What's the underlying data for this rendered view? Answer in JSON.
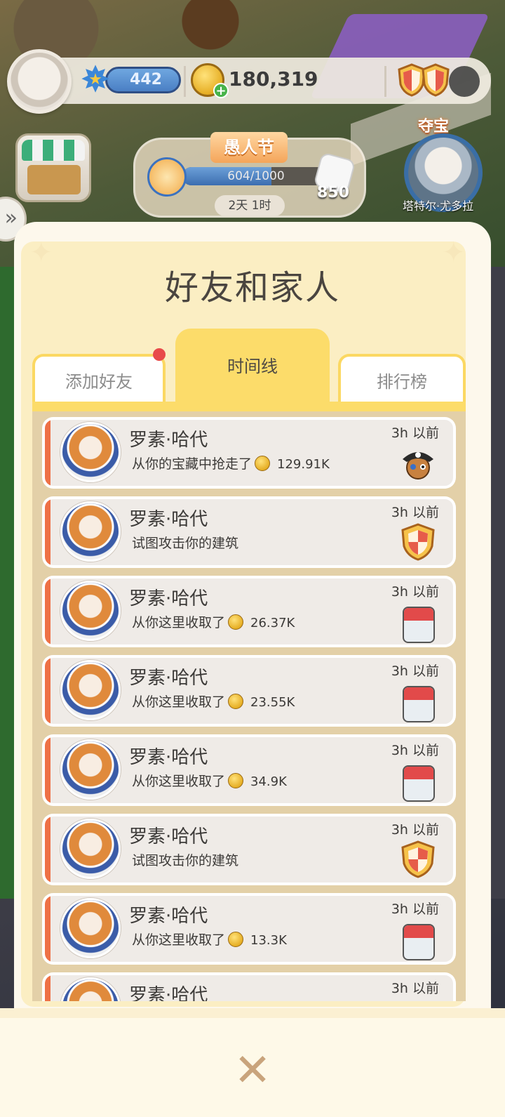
{
  "hud": {
    "level": "442",
    "coins": "180,319"
  },
  "event": {
    "title": "愚人节",
    "progress_text": "604/1000",
    "progress_fraction": 0.604,
    "dice_count": "850",
    "timer": "2天 1时"
  },
  "raid": {
    "title": "夺宝",
    "name": "塔特尔·尤多拉"
  },
  "modal": {
    "title": "好友和家人",
    "tabs": [
      {
        "label": "添加好友",
        "active": false,
        "badge": true
      },
      {
        "label": "时间线",
        "active": true
      },
      {
        "label": "排行榜",
        "active": false
      }
    ]
  },
  "timeline": [
    {
      "name": "罗素·哈代",
      "text": "从你的宝藏中抢走了",
      "amount": "129.91K",
      "time": "3h 以前",
      "icon": "pirate-icon"
    },
    {
      "name": "罗素·哈代",
      "text": "试图攻击你的建筑",
      "amount": "",
      "time": "3h 以前",
      "icon": "shield-icon"
    },
    {
      "name": "罗素·哈代",
      "text": "从你这里收取了",
      "amount": "26.37K",
      "time": "3h 以前",
      "icon": "calendar-icon"
    },
    {
      "name": "罗素·哈代",
      "text": "从你这里收取了",
      "amount": "23.55K",
      "time": "3h 以前",
      "icon": "calendar-icon"
    },
    {
      "name": "罗素·哈代",
      "text": "从你这里收取了",
      "amount": "34.9K",
      "time": "3h 以前",
      "icon": "calendar-icon"
    },
    {
      "name": "罗素·哈代",
      "text": "试图攻击你的建筑",
      "amount": "",
      "time": "3h 以前",
      "icon": "shield-icon"
    },
    {
      "name": "罗素·哈代",
      "text": "从你这里收取了",
      "amount": "13.3K",
      "time": "3h 以前",
      "icon": "calendar-icon"
    },
    {
      "name": "罗素·哈代",
      "text": "",
      "amount": "",
      "time": "3h 以前",
      "icon": ""
    }
  ],
  "colors": {
    "accent_yellow": "#fcdc6a",
    "item_bar": "#ee7146",
    "panel": "#e3d0a8"
  }
}
